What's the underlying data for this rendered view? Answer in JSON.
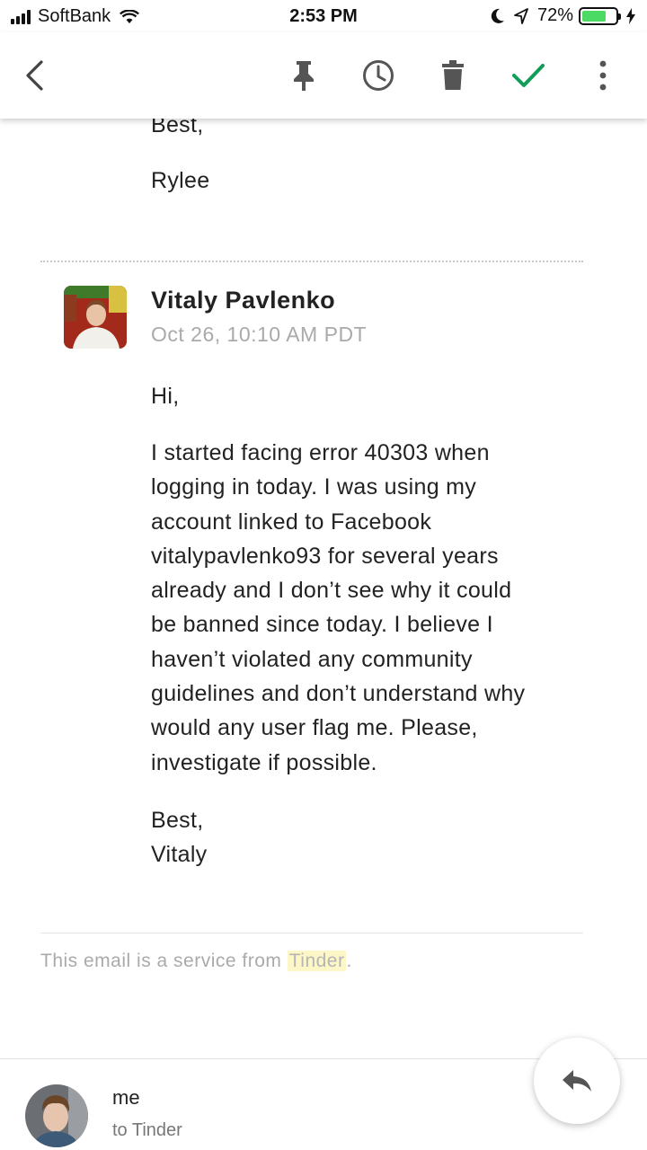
{
  "status_bar": {
    "carrier": "SoftBank",
    "time": "2:53 PM",
    "battery_percent": "72%",
    "battery_level": 0.72,
    "icons": [
      "signal-icon",
      "wifi-icon",
      "moon-icon",
      "location-arrow-icon",
      "battery-icon",
      "charging-bolt-icon"
    ]
  },
  "toolbar": {
    "icons": [
      "back-arrow-icon",
      "pin-icon",
      "clock-icon",
      "trash-icon",
      "checkmark-icon",
      "more-vertical-icon"
    ],
    "accent_color": "#0f9d58"
  },
  "thread": {
    "previous_message": {
      "closing": "Best,",
      "signature": "Rylee"
    },
    "message": {
      "sender_name": "Vitaly Pavlenko",
      "date": "Oct 26, 10:10 AM PDT",
      "greeting": "Hi,",
      "lines": [
        "I started facing error 40303 when",
        "logging in today. I was using my",
        "account linked to Facebook",
        "vitalypavlenko93 for several years",
        "already and I don’t see why it could",
        "be banned since today. I believe I",
        "haven’t violated any community",
        "guidelines and don’t understand why",
        "would any user flag me. Please,",
        "investigate if possible."
      ],
      "closing": "Best,",
      "signature": "Vitaly"
    },
    "footer": {
      "prefix": "This email is a service from ",
      "highlight": "Tinder",
      "suffix": "."
    }
  },
  "reply_bar": {
    "from": "me",
    "to": "to Tinder",
    "reply_icon": "reply-arrow-icon"
  }
}
